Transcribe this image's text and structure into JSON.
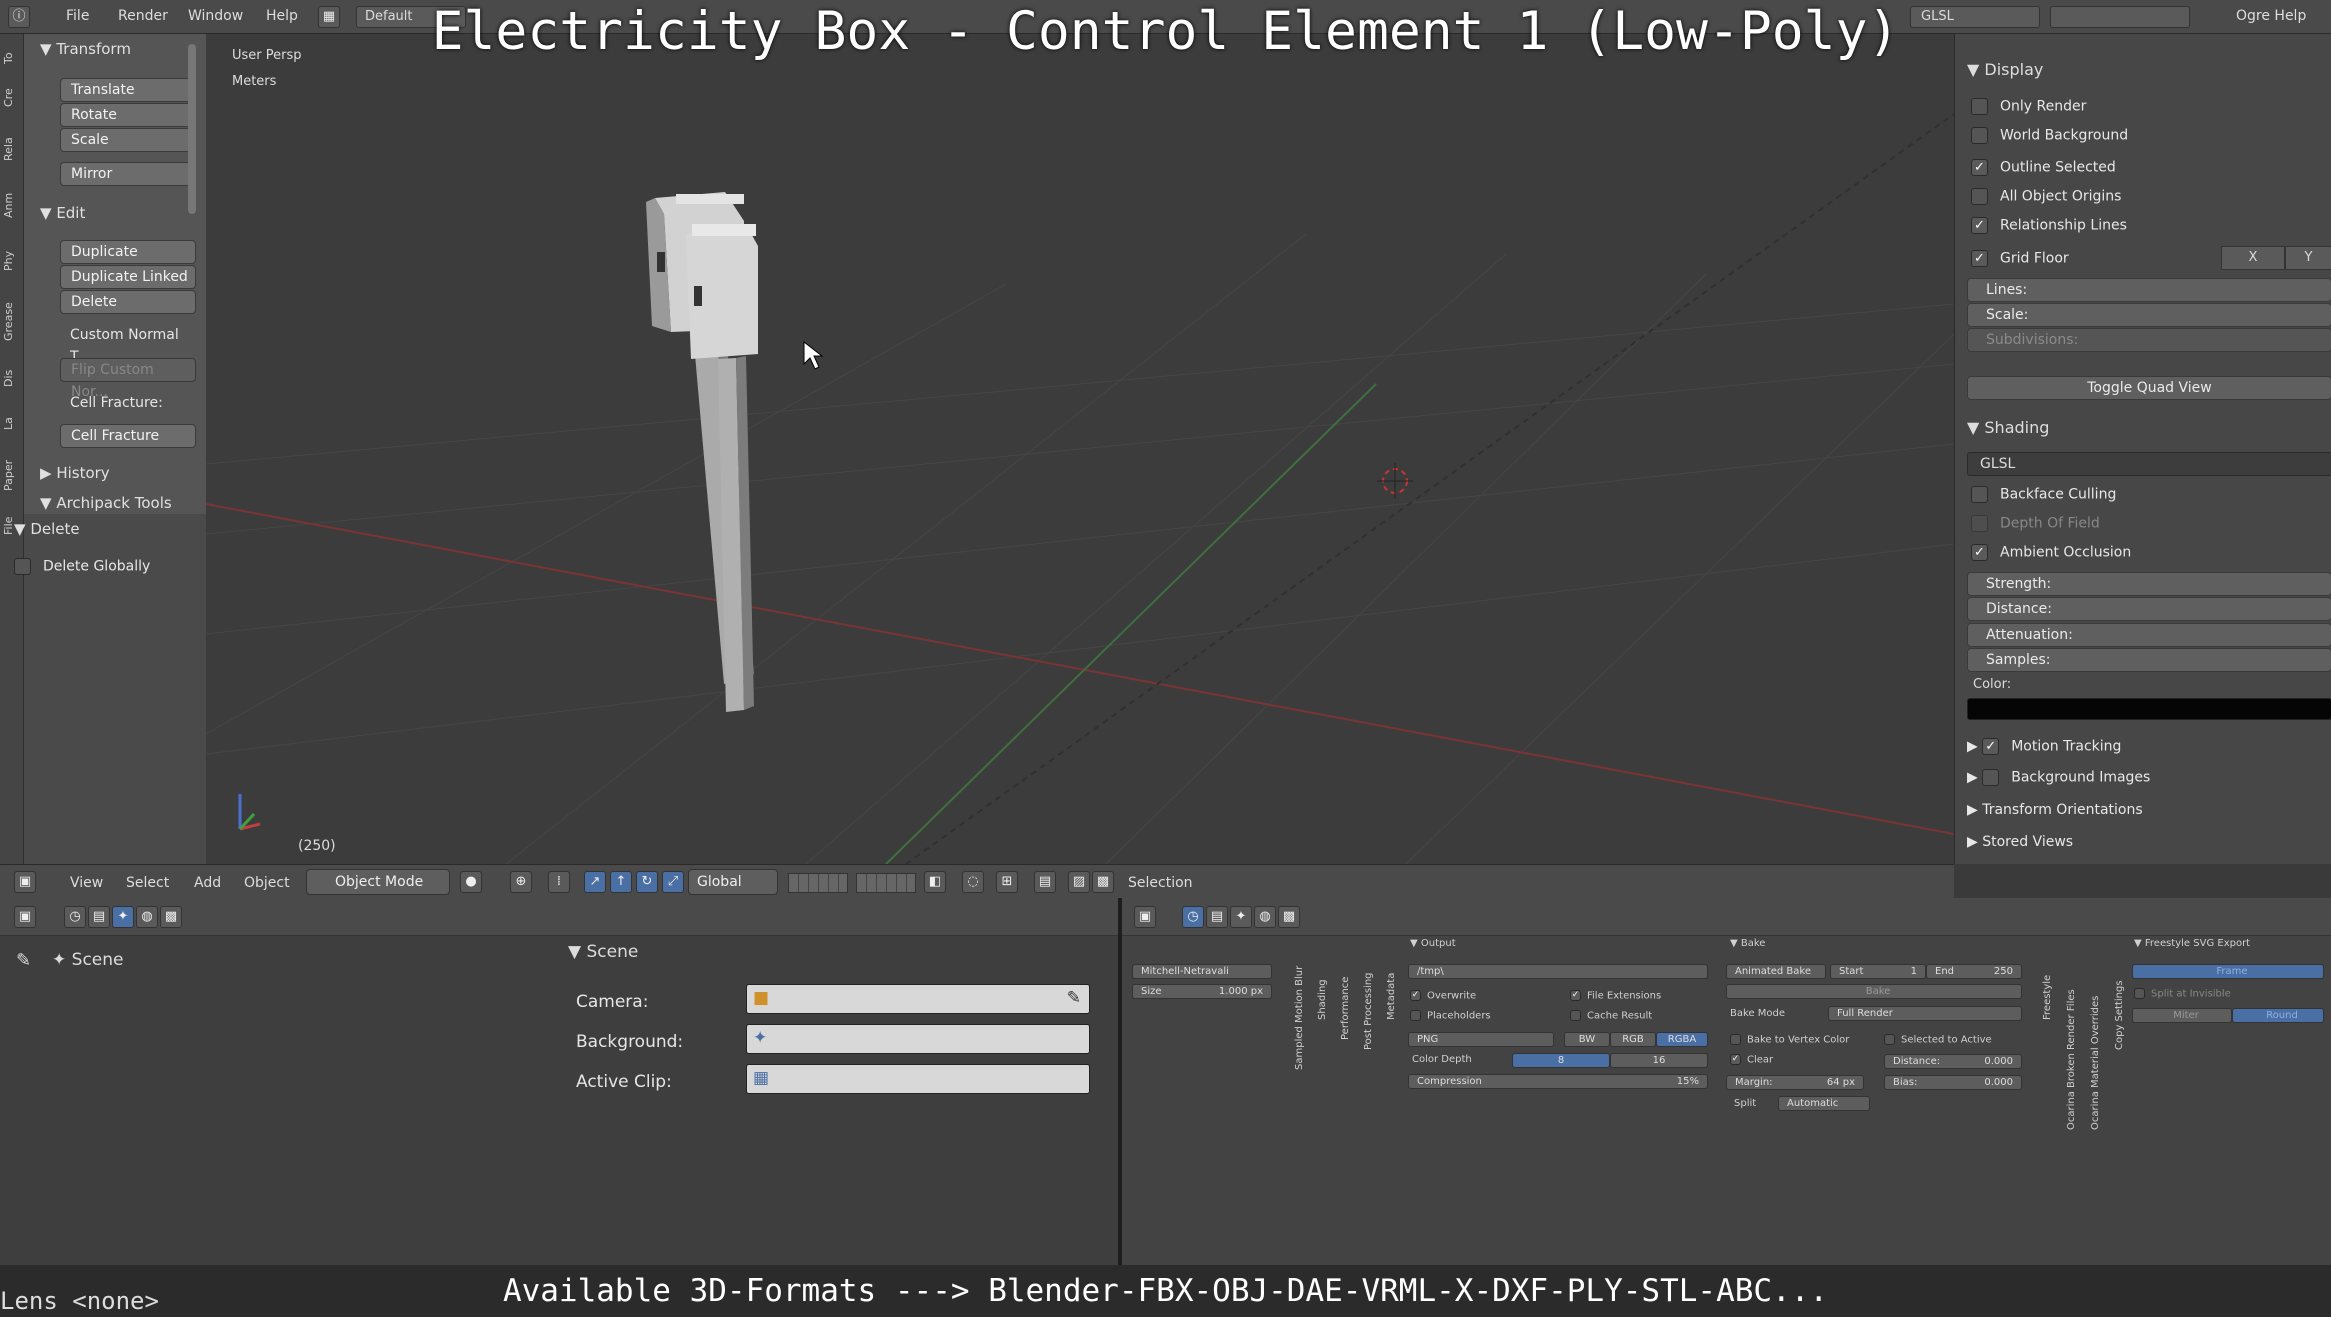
{
  "overlay": {
    "title": "Electricity Box - Control Element 1 (Low-Poly)",
    "footer": "Available 3D-Formats ---> Blender-FBX-OBJ-DAE-VRML-X-DXF-PLY-STL-ABC...",
    "lens": "Lens <none>"
  },
  "topbar": {
    "menus": [
      "File",
      "Render",
      "Window",
      "Help"
    ],
    "layout": "Default",
    "engine_label": "GLSL",
    "help": "Ogre Help"
  },
  "tabs": [
    "To",
    "Cre",
    "Rela",
    "Anm",
    "Phy",
    "Grease",
    "Dis",
    "La",
    "Paper",
    "File"
  ],
  "toolshelf": {
    "transform_header": "Transform",
    "translate": "Translate",
    "rotate": "Rotate",
    "scale": "Scale",
    "mirror": "Mirror",
    "edit_header": "Edit",
    "duplicate": "Duplicate",
    "duplicate_linked": "Duplicate Linked",
    "delete": "Delete",
    "custom_normal": "Custom Normal T...",
    "flip_normal": "Flip Custom Nor...",
    "cell_fracture_label": "Cell Fracture:",
    "cell_fracture": "Cell Fracture",
    "history_header": "History",
    "archipack_header": "Archipack Tools",
    "delete_panel_header": "Delete",
    "delete_globally": "Delete Globally"
  },
  "viewport": {
    "view_name": "User Persp",
    "units": "Meters",
    "frame": "(250)"
  },
  "props": {
    "display_header": "Display",
    "only_render": "Only Render",
    "world_background": "World Background",
    "outline_selected": "Outline Selected",
    "all_origins": "All Object Origins",
    "relationship_lines": "Relationship Lines",
    "grid_floor": "Grid Floor",
    "axis_x": "X",
    "axis_y": "Y",
    "lines": "Lines:",
    "scale": "Scale:",
    "subdivisions": "Subdivisions:",
    "toggle_quad": "Toggle Quad View",
    "shading_header": "Shading",
    "shading_mode": "GLSL",
    "backface": "Backface Culling",
    "depth_of_field": "Depth Of Field",
    "ambient_occlusion": "Ambient Occlusion",
    "strength": "Strength:",
    "distance": "Distance:",
    "attenuation": "Attenuation:",
    "samples": "Samples:",
    "color": "Color:",
    "motion_tracking": "Motion Tracking",
    "background_images": "Background Images",
    "transform_orientations": "Transform Orientations",
    "stored_views": "Stored Views"
  },
  "header3d": {
    "view": "View",
    "select": "Select",
    "add": "Add",
    "object": "Object",
    "mode": "Object Mode",
    "orientation": "Global",
    "selection": "Selection"
  },
  "scene_panel": {
    "header": "Scene",
    "breadcrumb": "Scene",
    "camera": "Camera:",
    "background": "Background:",
    "active_clip": "Active Clip:"
  },
  "render_panel": {
    "output": "Output",
    "bake": "Bake",
    "freestyle": "Freestyle SVG Export",
    "preset": "Mitchell-Netravali",
    "size": "Size",
    "size_val": "1.000 px",
    "path": "/tmp\\",
    "overwrite": "Overwrite",
    "file_ext": "File Extensions",
    "placeholders": "Placeholders",
    "cache_result": "Cache Result",
    "format": "PNG",
    "bw": "BW",
    "rgb": "RGB",
    "rgba": "RGBA",
    "color_depth": "Color Depth",
    "depth8": "8",
    "depth16": "16",
    "compression": "Compression",
    "compression_val": "15%",
    "animated_bake": "Animated Bake",
    "start": "Start",
    "start_val": "1",
    "end": "End",
    "end_val": "250",
    "bake_btn": "Bake",
    "bake_mode": "Bake Mode",
    "bake_mode_val": "Full Render",
    "bake_vertex": "Bake to Vertex Color",
    "selected_active": "Selected to Active",
    "clear": "Clear",
    "distance": "Distance:",
    "distance_val": "0.000",
    "margin": "Margin:",
    "margin_val": "64 px",
    "bias": "Bias:",
    "bias_val": "0.000",
    "split": "Split",
    "split_val": "Automatic",
    "frame": "Frame",
    "split_invisible": "Split at Invisible",
    "miter": "Miter",
    "round": "Round",
    "v_labels": [
      "Sampled Motion Blur",
      "Shading",
      "Performance",
      "Post Processing",
      "Metadata",
      "Freestyle",
      "Ocarina Broken Render Files",
      "Ocarina Material Overrides",
      "Copy Settings"
    ]
  }
}
